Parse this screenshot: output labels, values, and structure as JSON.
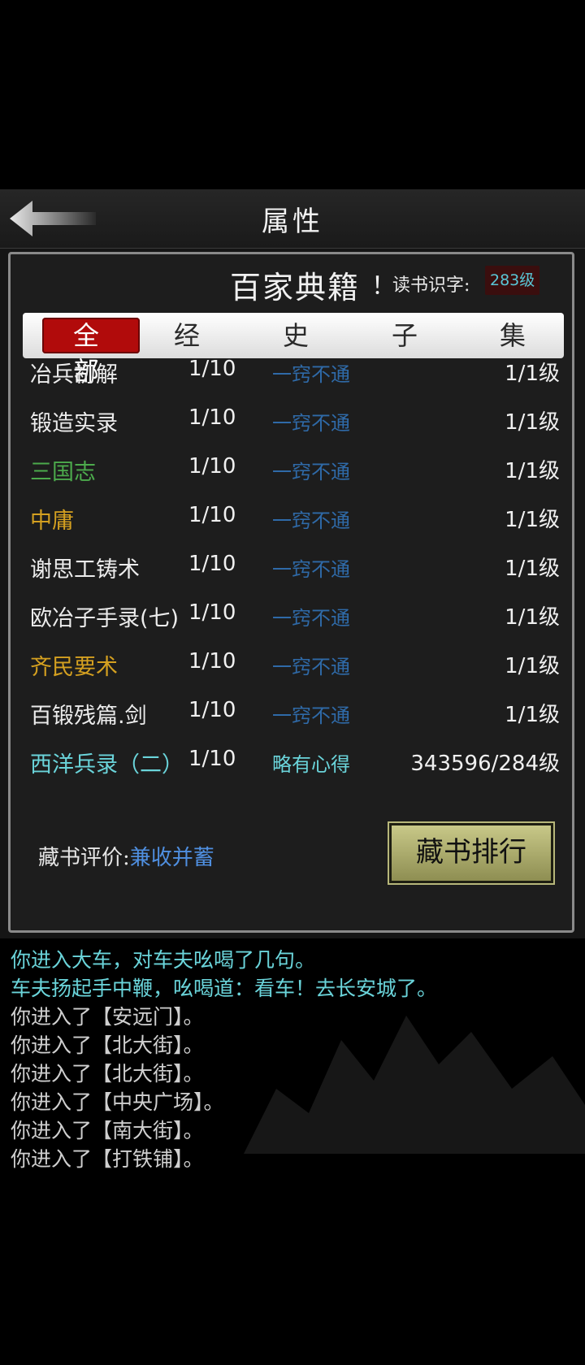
{
  "header": {
    "title": "属性"
  },
  "dialog": {
    "title": "百家典籍",
    "exclaim": "！",
    "reading_label": "读书识字:",
    "reading_level": "283级",
    "tabs": [
      "全 部",
      "经",
      "史",
      "子",
      "集"
    ],
    "books": [
      {
        "name": "冶兵初解",
        "progress": "1/10",
        "state": "一窍不通",
        "level": "1/1级",
        "color": "#ececec",
        "state_color": "#2f6aa8"
      },
      {
        "name": "锻造实录",
        "progress": "1/10",
        "state": "一窍不通",
        "level": "1/1级",
        "color": "#ececec",
        "state_color": "#2f6aa8"
      },
      {
        "name": "三国志",
        "progress": "1/10",
        "state": "一窍不通",
        "level": "1/1级",
        "color": "#4caa4c",
        "state_color": "#2f6aa8"
      },
      {
        "name": "中庸",
        "progress": "1/10",
        "state": "一窍不通",
        "level": "1/1级",
        "color": "#d4a020",
        "state_color": "#2f6aa8"
      },
      {
        "name": "谢思工铸术",
        "progress": "1/10",
        "state": "一窍不通",
        "level": "1/1级",
        "color": "#ececec",
        "state_color": "#2f6aa8"
      },
      {
        "name": "欧冶子手录(七)",
        "progress": "1/10",
        "state": "一窍不通",
        "level": "1/1级",
        "color": "#ececec",
        "state_color": "#2f6aa8"
      },
      {
        "name": "齐民要术",
        "progress": "1/10",
        "state": "一窍不通",
        "level": "1/1级",
        "color": "#d4a020",
        "state_color": "#2f6aa8"
      },
      {
        "name": "百锻残篇.剑",
        "progress": "1/10",
        "state": "一窍不通",
        "level": "1/1级",
        "color": "#ececec",
        "state_color": "#2f6aa8"
      },
      {
        "name": "西洋兵录（二）",
        "progress": "1/10",
        "state": "略有心得",
        "level": "343596/284级",
        "color": "#6ad4da",
        "state_color": "#6ad4da"
      }
    ],
    "collection_label": "藏书评价:",
    "collection_value": "兼收并蓄",
    "rank_button": "藏书排行"
  },
  "log": [
    {
      "text": "你进入大车，对车夫吆喝了几句。",
      "color": "#6ad4da"
    },
    {
      "text": "车夫扬起手中鞭，吆喝道：看车！去长安城了。",
      "color": "#6ad4da"
    },
    {
      "text": "你进入了【安远门】。",
      "color": "#cfcfcf"
    },
    {
      "text": "你进入了【北大街】。",
      "color": "#cfcfcf"
    },
    {
      "text": "你进入了【北大街】。",
      "color": "#cfcfcf"
    },
    {
      "text": "你进入了【中央广场】。",
      "color": "#cfcfcf"
    },
    {
      "text": "你进入了【南大街】。",
      "color": "#cfcfcf"
    },
    {
      "text": "你进入了【打铁铺】。",
      "color": "#cfcfcf"
    }
  ],
  "icons": {
    "back": "back-arrow-icon"
  }
}
